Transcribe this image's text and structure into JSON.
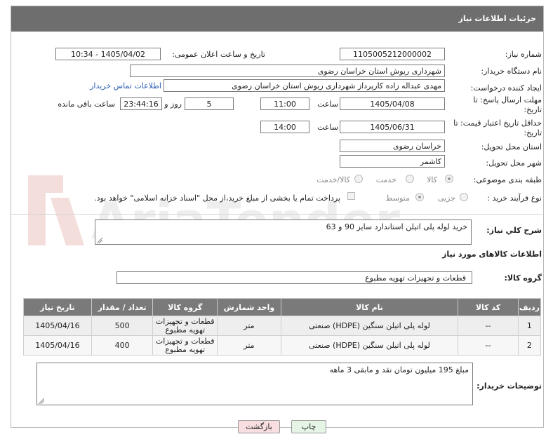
{
  "header": {
    "title": "جزئیات اطلاعات نیاز"
  },
  "labels": {
    "need_number": "شماره نیاز:",
    "announce_datetime": "تاریخ و ساعت اعلان عمومی:",
    "buyer_org": "نام دستگاه خریدار:",
    "requester": "ایجاد کننده درخواست:",
    "reply_deadline": "مهلت ارسال پاسخ: تا تاریخ:",
    "price_validity": "حداقل تاریخ اعتبار قیمت: تا تاریخ:",
    "time": "ساعت",
    "day_and": "روز و",
    "hours_left": "ساعت باقی مانده",
    "delivery_province": "استان محل تحویل:",
    "delivery_city": "شهر محل تحویل:",
    "category": "طبقه بندی موضوعی:",
    "process_type": "نوع فرآیند خرید :",
    "general_desc": "شرح کلي نياز:",
    "goods_info": "اطلاعات کالاهای مورد نیاز",
    "goods_group": "گروه کالا:",
    "buyer_notes": "توضیحات خریدار:"
  },
  "fields": {
    "need_number": "1105005212000002",
    "announce_datetime": "1405/04/02 - 10:34",
    "buyer_org": "شهرداری ریوش استان خراسان رضوی",
    "requester": "مهدی عبداله زاده کارپرداز شهرداری ریوش استان خراسان رضوی",
    "buyer_contact_link": "اطلاعات تماس خریدار",
    "reply_date": "1405/04/08",
    "reply_time": "11:00",
    "days_left": "5",
    "time_left": "23:44:16",
    "validity_date": "1405/06/31",
    "validity_time": "14:00",
    "province": "خراسان رضوی",
    "city": "کاشمر",
    "general_desc": "خرید لوله پلی اتیلن استاندارد سایز 90 و 63",
    "goods_group": "قطعات و تجهیزات تهویه مطبوع",
    "buyer_notes": "مبلغ 195 میلیون تومان نقد و مابقی 3 ماهه"
  },
  "category_options": [
    {
      "label": "کالا",
      "selected": true
    },
    {
      "label": "خدمت",
      "selected": false
    },
    {
      "label": "کالا/خدمت",
      "selected": false
    }
  ],
  "process_options": [
    {
      "label": "جزیی",
      "selected": false
    },
    {
      "label": "متوسط",
      "selected": true
    }
  ],
  "payment_note": "پرداخت تمام یا بخشی از مبلغ خرید،از محل \"اسناد خزانه اسلامی\" خواهد بود.",
  "table": {
    "headers": [
      "ردیف",
      "کد کالا",
      "نام کالا",
      "واحد شمارش",
      "گروه کالا",
      "تعداد / مقدار",
      "تاریخ نیاز"
    ],
    "rows": [
      [
        "1",
        "--",
        "لوله پلی اتیلن سنگین (HDPE) صنعتی",
        "متر",
        "قطعات و تجهیزات تهویه مطبوع",
        "500",
        "1405/04/16"
      ],
      [
        "2",
        "--",
        "لوله پلی اتیلن سنگین (HDPE) صنعتی",
        "متر",
        "قطعات و تجهیزات تهویه مطبوع",
        "400",
        "1405/04/16"
      ]
    ]
  },
  "buttons": {
    "print": "چاپ",
    "back": "بازگشت"
  },
  "watermark": "AriaTender.net",
  "colors": {
    "header_bg": "#6e6e6e",
    "link": "#2a5db0",
    "back_button_bg": "#f8dede",
    "print_button_bg": "#e6f4e6"
  }
}
